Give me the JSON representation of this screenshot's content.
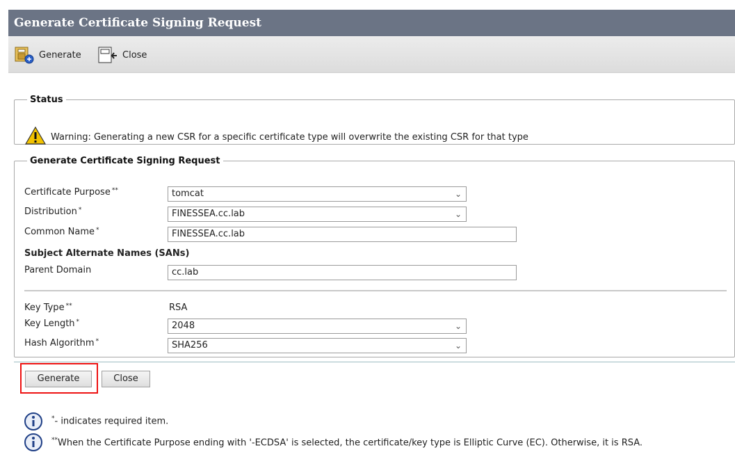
{
  "window": {
    "title": "Generate Certificate Signing Request"
  },
  "toolbar": {
    "generate_label": "Generate",
    "close_label": "Close"
  },
  "status": {
    "legend": "Status",
    "icon": "warning-icon",
    "message": "Warning: Generating a new CSR for a specific certificate type will overwrite the existing CSR for that type"
  },
  "csr": {
    "legend": "Generate Certificate Signing Request",
    "certificate_purpose": {
      "label": "Certificate Purpose",
      "marker": "**",
      "value": "tomcat"
    },
    "distribution": {
      "label": "Distribution",
      "marker": "*",
      "value": "FINESSEA.cc.lab"
    },
    "common_name": {
      "label": "Common Name",
      "marker": "*",
      "value": "FINESSEA.cc.lab"
    },
    "sans_heading": "Subject Alternate Names (SANs)",
    "parent_domain": {
      "label": "Parent Domain",
      "value": "cc.lab"
    },
    "key_type": {
      "label": "Key Type",
      "marker": "**",
      "value": "RSA"
    },
    "key_length": {
      "label": "Key Length",
      "marker": "*",
      "value": "2048"
    },
    "hash_algorithm": {
      "label": "Hash Algorithm",
      "marker": "*",
      "value": "SHA256"
    }
  },
  "buttons": {
    "generate": "Generate",
    "close": "Close"
  },
  "notes": {
    "required_marker": "*",
    "required_text": "- indicates required item.",
    "ecdsa_marker": "**",
    "ecdsa_text": "When the Certificate Purpose ending with '-ECDSA' is selected, the certificate/key type is Elliptic Curve (EC). Otherwise, it is RSA."
  },
  "colors": {
    "titlebar": "#6b7485",
    "highlight": "#e11111"
  }
}
